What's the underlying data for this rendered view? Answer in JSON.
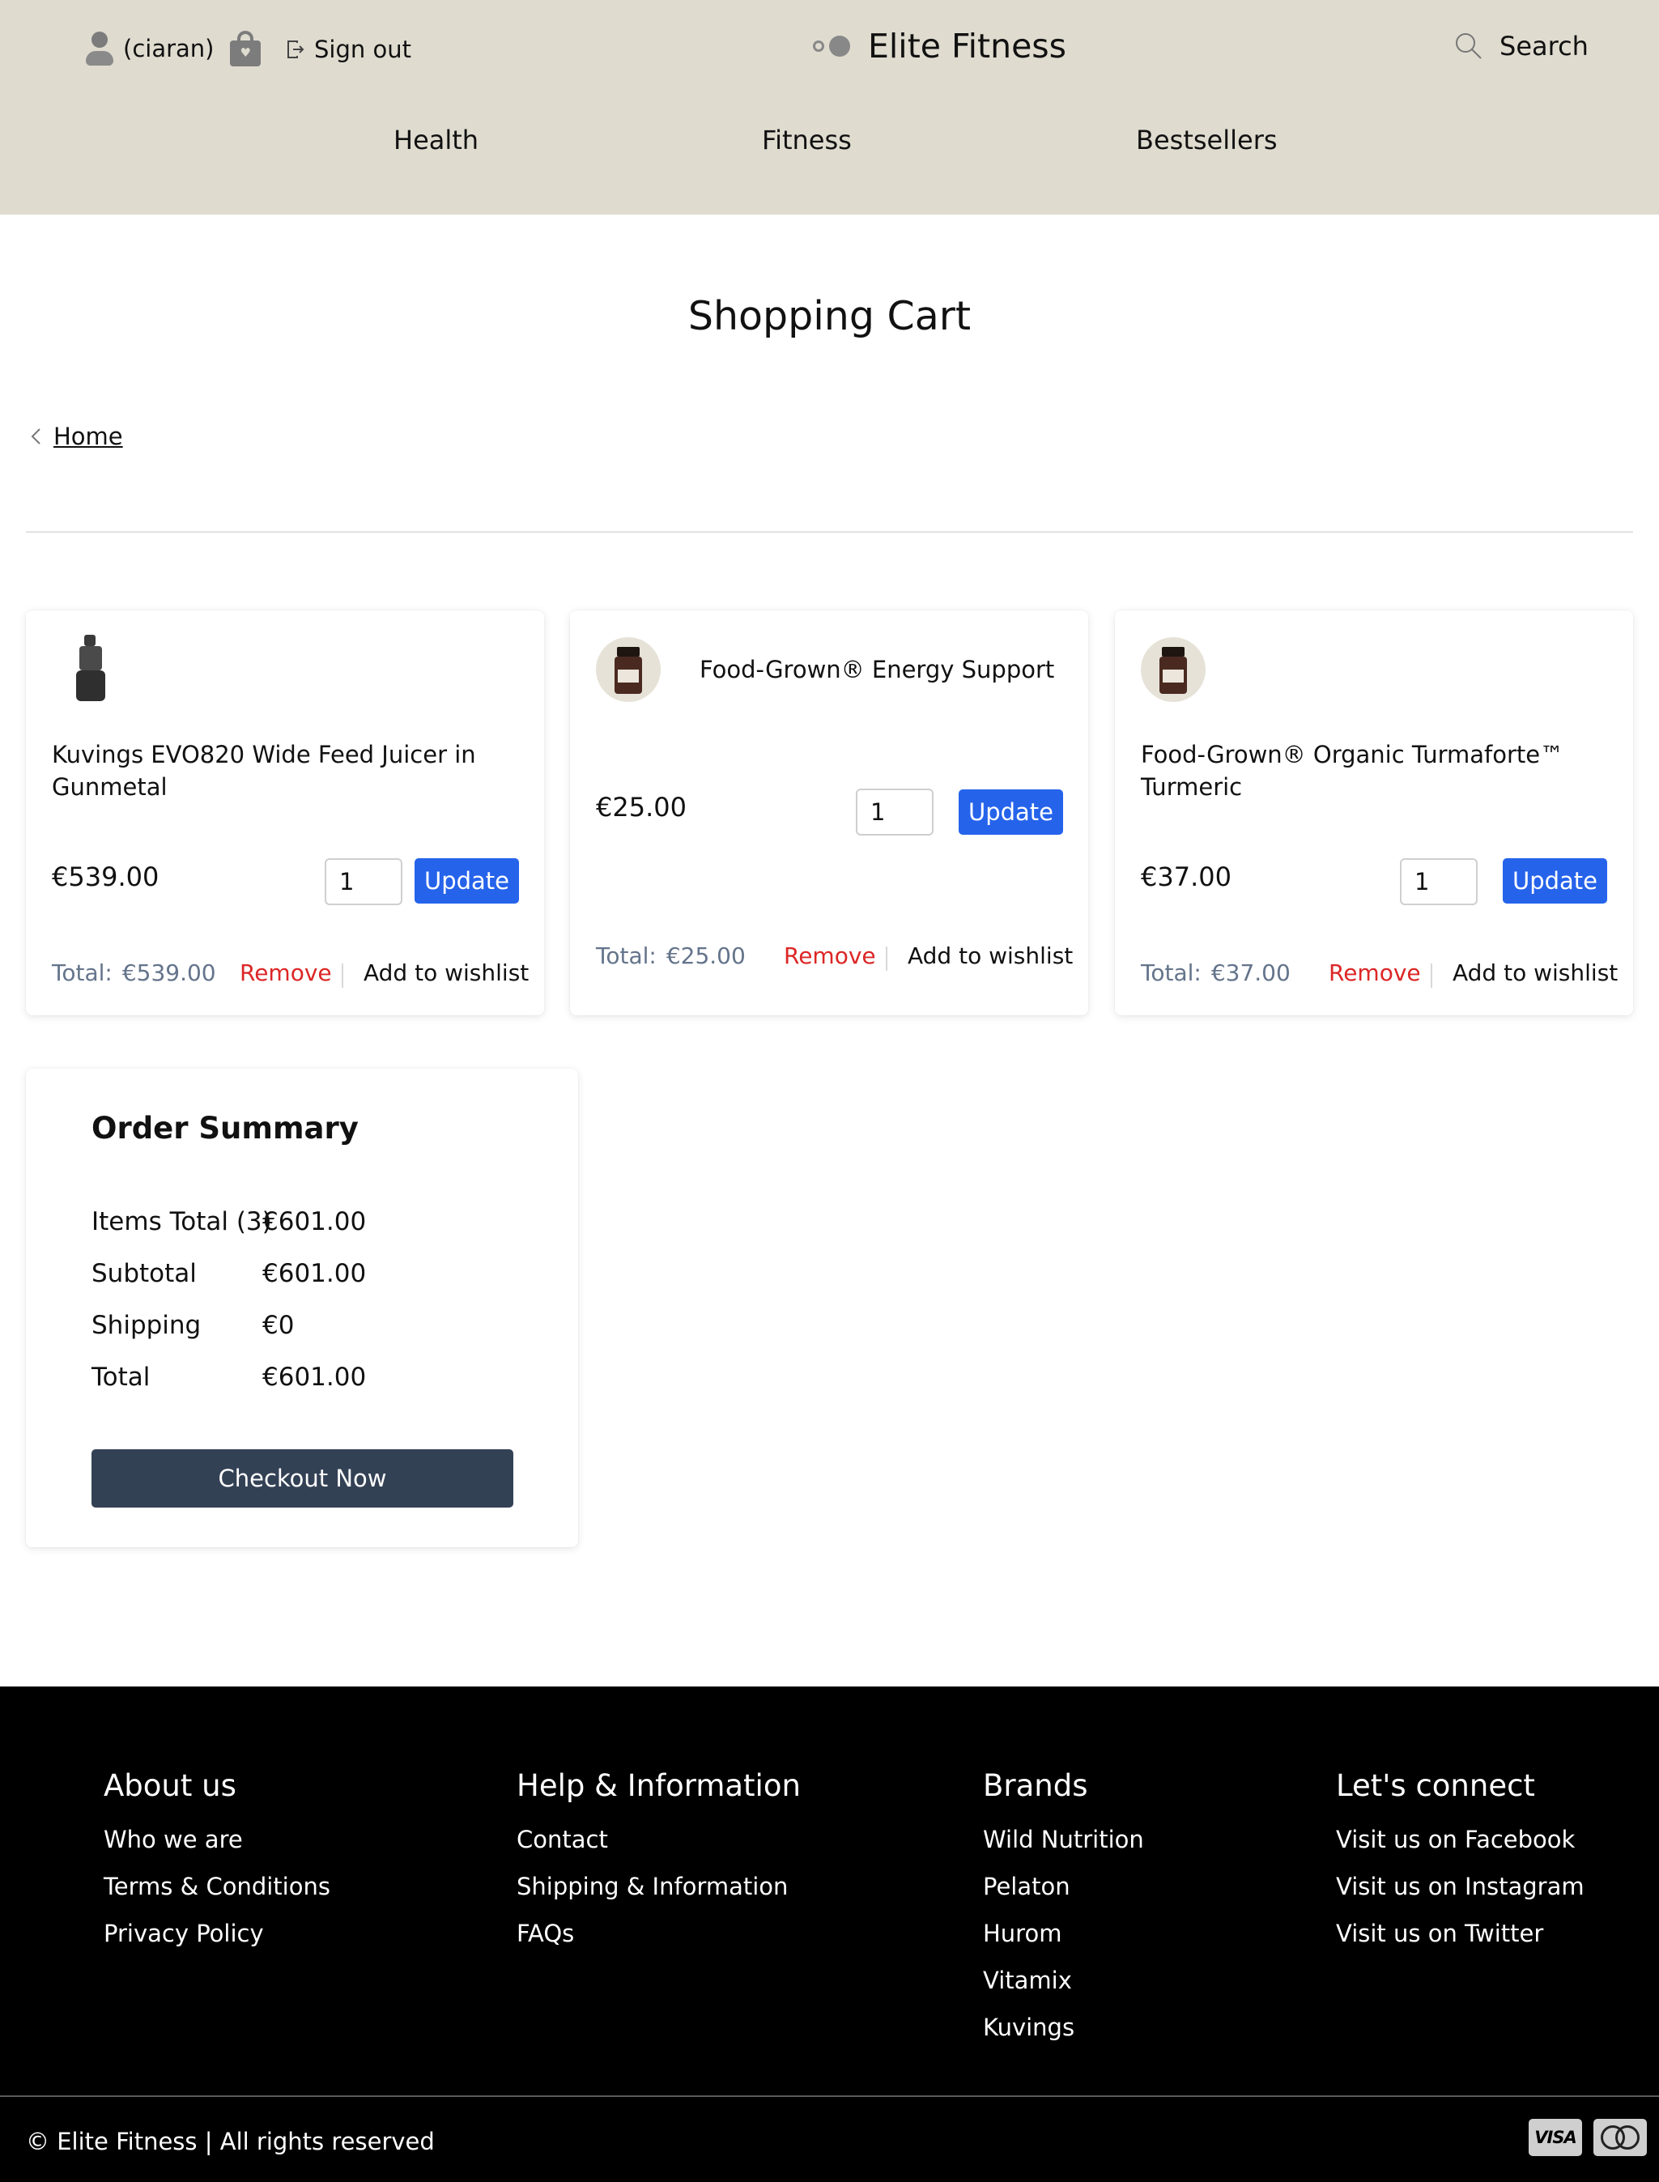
{
  "header": {
    "username": "(ciaran)",
    "sign_out": "Sign out",
    "brand": "Elite Fitness",
    "search": "Search",
    "nav": [
      "Health",
      "Fitness",
      "Bestsellers"
    ]
  },
  "page": {
    "title": "Shopping Cart",
    "breadcrumb_home": "Home"
  },
  "cart": {
    "items": [
      {
        "name": "Kuvings EVO820 Wide Feed Juicer in Gunmetal",
        "price": "€539.00",
        "qty": "1",
        "update_label": "Update",
        "total_label": "Total:",
        "total_value": "€539.00",
        "remove_label": "Remove",
        "wishlist_label": "Add to wishlist"
      },
      {
        "name": "Food-Grown® Energy Support",
        "price": "€25.00",
        "qty": "1",
        "update_label": "Update",
        "total_label": "Total:",
        "total_value": "€25.00",
        "remove_label": "Remove",
        "wishlist_label": "Add to wishlist"
      },
      {
        "name": "Food-Grown® Organic Turmaforte™ Turmeric",
        "price": "€37.00",
        "qty": "1",
        "update_label": "Update",
        "total_label": "Total:",
        "total_value": "€37.00",
        "remove_label": "Remove",
        "wishlist_label": "Add to wishlist"
      }
    ]
  },
  "summary": {
    "title": "Order Summary",
    "rows": [
      {
        "label": "Items Total (3)",
        "value": "€601.00"
      },
      {
        "label": "Subtotal",
        "value": "€601.00"
      },
      {
        "label": "Shipping",
        "value": "€0"
      },
      {
        "label": "Total",
        "value": "€601.00"
      }
    ],
    "checkout": "Checkout Now"
  },
  "footer": {
    "columns": [
      {
        "heading": "About us",
        "links": [
          "Who we are",
          "Terms & Conditions",
          "Privacy Policy"
        ]
      },
      {
        "heading": "Help & Information",
        "links": [
          "Contact",
          "Shipping & Information",
          "FAQs"
        ]
      },
      {
        "heading": "Brands",
        "links": [
          "Wild Nutrition",
          "Pelaton",
          "Hurom",
          "Vitamix",
          "Kuvings"
        ]
      },
      {
        "heading": "Let's connect",
        "links": [
          "Visit us on Facebook",
          "Visit us on Instagram",
          "Visit us on Twitter"
        ]
      }
    ],
    "copyright": "© Elite Fitness | All rights reserved",
    "payment_icons": [
      "visa-icon",
      "mastercard-icon"
    ],
    "visa_text": "VISA"
  },
  "colors": {
    "header_bg": "#dfdbcf",
    "update_button": "#2563eb",
    "remove_text": "#dc2626",
    "checkout_button": "#334155",
    "footer_bg": "#000000"
  }
}
